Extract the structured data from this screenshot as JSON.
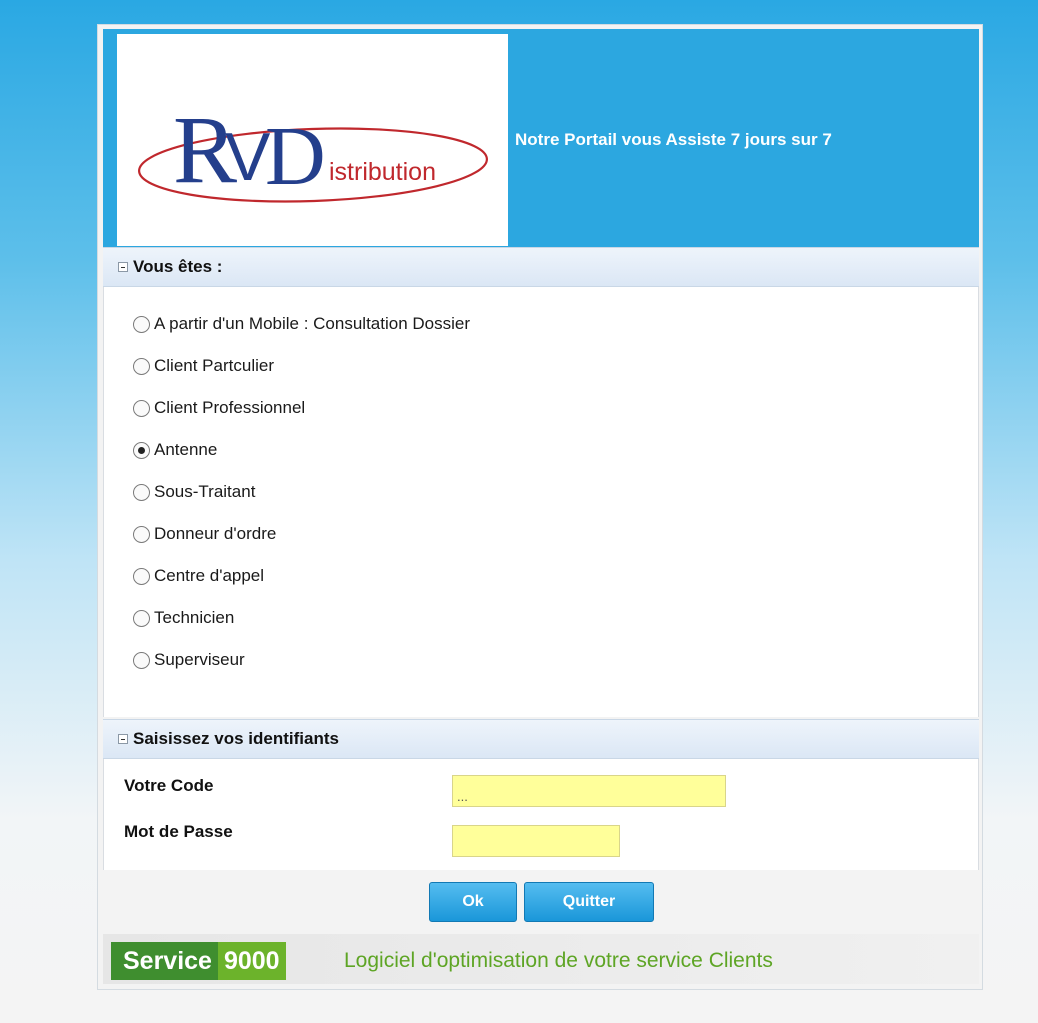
{
  "header": {
    "logo_big_r": "R",
    "logo_v": "V",
    "logo_big_d": "D",
    "logo_rest": "istribution",
    "tagline": "Notre Portail vous Assiste 7 jours sur 7"
  },
  "section_role": {
    "title": "Vous êtes :",
    "options": [
      {
        "label": "A partir d'un Mobile : Consultation Dossier",
        "checked": false
      },
      {
        "label": "Client Partculier",
        "checked": false
      },
      {
        "label": "Client Professionnel",
        "checked": false
      },
      {
        "label": "Antenne",
        "checked": true
      },
      {
        "label": "Sous-Traitant",
        "checked": false
      },
      {
        "label": "Donneur d'ordre",
        "checked": false
      },
      {
        "label": "Centre d'appel",
        "checked": false
      },
      {
        "label": "Technicien",
        "checked": false
      },
      {
        "label": "Superviseur",
        "checked": false
      }
    ]
  },
  "section_login": {
    "title": "Saisissez vos identifiants",
    "code_label": "Votre Code",
    "code_value": "...",
    "password_label": "Mot de Passe",
    "password_value": ""
  },
  "buttons": {
    "ok": "Ok",
    "quit": "Quitter"
  },
  "footer": {
    "brand_a": "Service",
    "brand_b": "9000",
    "slogan": "Logiciel d'optimisation de votre service Clients"
  },
  "colors": {
    "header_blue": "#2ca7e0",
    "logo_navy": "#243f8c",
    "logo_red": "#c0282d",
    "field_yellow": "#ffff9a",
    "service_dark_green": "#3f8e2f",
    "service_light_green": "#6cb32b"
  }
}
